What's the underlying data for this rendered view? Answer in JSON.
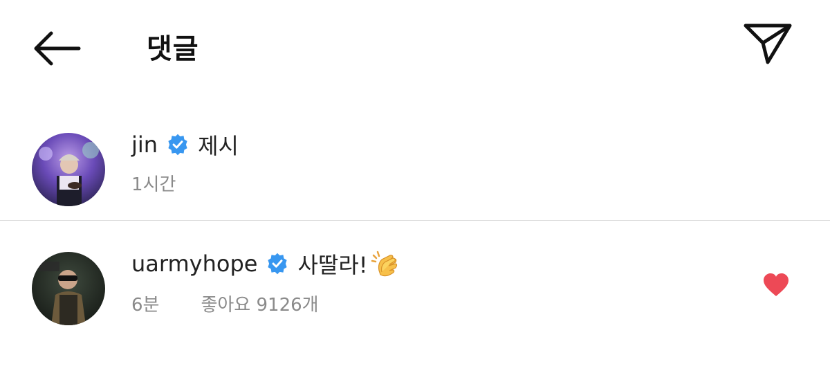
{
  "header": {
    "title": "댓글",
    "back_icon": "arrow-left-icon",
    "share_icon": "paper-plane-icon"
  },
  "comments": [
    {
      "username": "jin",
      "verified": true,
      "text": "제시",
      "time": "1시간",
      "avatar": "avatar"
    },
    {
      "username": "uarmyhope",
      "verified": true,
      "text": "사딸라!",
      "emoji": "clapping-hands-icon",
      "time": "6분",
      "likes": "좋아요 9126개",
      "liked": true,
      "heart_icon": "heart-icon"
    }
  ],
  "colors": {
    "verified_blue": "#3897f0",
    "heart_red": "#ed4956",
    "divider": "#dcdcdc",
    "meta_grey": "#8a8a8a"
  }
}
